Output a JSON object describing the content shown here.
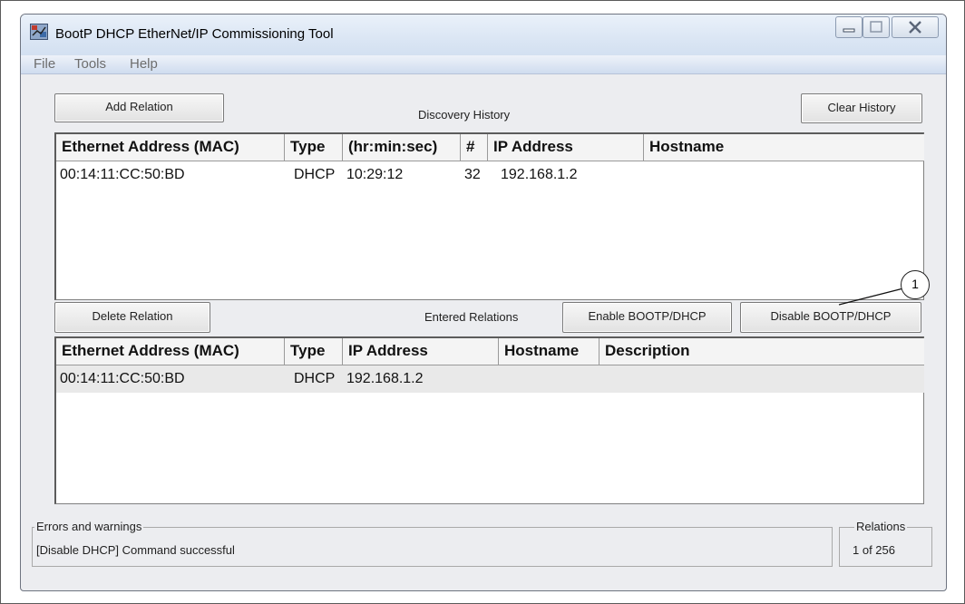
{
  "window": {
    "title": "BootP DHCP EtherNet/IP Commissioning Tool"
  },
  "menu": [
    "File",
    "Tools",
    "Help"
  ],
  "discovery": {
    "add_button": "Add Relation",
    "section_label": "Discovery History",
    "clear_button": "Clear History",
    "columns": [
      "Ethernet Address (MAC)",
      "Type",
      "(hr:min:sec)",
      "#",
      "IP Address",
      "Hostname"
    ],
    "rows": [
      {
        "mac": "00:14:11:CC:50:BD",
        "type": "DHCP",
        "time": "10:29:12",
        "count": "32",
        "ip": "192.168.1.2",
        "hostname": ""
      }
    ]
  },
  "relations": {
    "delete_button": "Delete Relation",
    "section_label": "Entered Relations",
    "enable_button": "Enable BOOTP/DHCP",
    "disable_button": "Disable BOOTP/DHCP",
    "columns": [
      "Ethernet Address (MAC)",
      "Type",
      "IP Address",
      "Hostname",
      "Description"
    ],
    "rows": [
      {
        "mac": "00:14:11:CC:50:BD",
        "type": "DHCP",
        "ip": "192.168.1.2",
        "hostname": "",
        "description": ""
      }
    ]
  },
  "status": {
    "errors_title": "Errors and warnings",
    "errors_text": "[Disable DHCP] Command successful",
    "relations_title": "Relations",
    "relations_text": "1 of 256"
  },
  "callout": {
    "number": "1"
  },
  "icons": [
    "app-icon",
    "minimize-icon",
    "maximize-icon",
    "close-icon"
  ]
}
